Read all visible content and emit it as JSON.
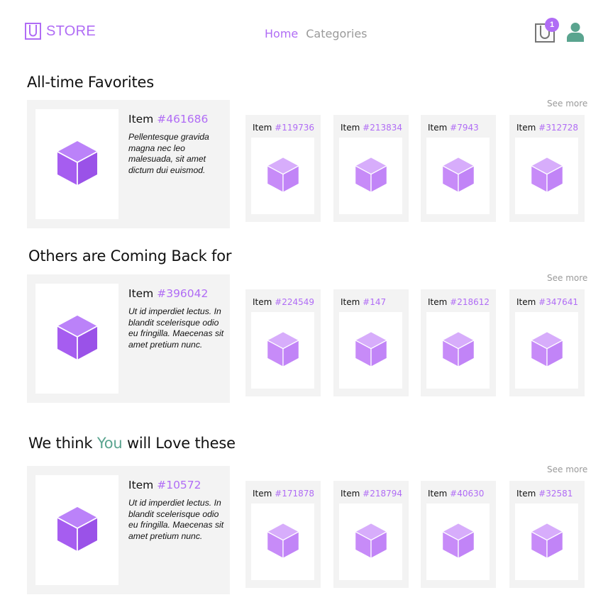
{
  "header": {
    "brand": "STORE",
    "nav": [
      {
        "label": "Home",
        "active": true
      },
      {
        "label": "Categories",
        "active": false
      }
    ],
    "cart_count": "1"
  },
  "colors": {
    "accent": "#b06cf5",
    "secondary": "#5aa48f",
    "muted": "#9a9a9a",
    "card_bg": "#f3f3f3"
  },
  "sections": [
    {
      "title_pre": "All-time Favorites",
      "title_hl": "",
      "title_post": "",
      "see_more": "See more",
      "featured": {
        "prefix": "Item ",
        "number": "#461686",
        "desc": "Pellentesque gravida magna nec leo malesuada, sit amet dictum dui euismod."
      },
      "items": [
        {
          "prefix": "Item ",
          "number": "#119736"
        },
        {
          "prefix": "Item ",
          "number": "#213834"
        },
        {
          "prefix": "Item ",
          "number": "#7943"
        },
        {
          "prefix": "Item ",
          "number": "#312728"
        }
      ]
    },
    {
      "title_pre": "Others are Coming Back for",
      "title_hl": "",
      "title_post": "",
      "see_more": "See more",
      "featured": {
        "prefix": "Item ",
        "number": "#396042",
        "desc": "Ut id imperdiet lectus. In blandit scelerisque odio eu fringilla. Maecenas sit amet pretium nunc."
      },
      "items": [
        {
          "prefix": "Item ",
          "number": "#224549"
        },
        {
          "prefix": "Item ",
          "number": "#147"
        },
        {
          "prefix": "Item ",
          "number": "#218612"
        },
        {
          "prefix": "Item ",
          "number": "#347641"
        }
      ]
    },
    {
      "title_pre": "We think ",
      "title_hl": "You",
      "title_post": " will Love these",
      "see_more": "See more",
      "featured": {
        "prefix": "Item ",
        "number": "#10572",
        "desc": "Ut id imperdiet lectus. In blandit scelerisque odio eu fringilla. Maecenas sit amet pretium nunc."
      },
      "items": [
        {
          "prefix": "Item ",
          "number": "#171878"
        },
        {
          "prefix": "Item ",
          "number": "#218794"
        },
        {
          "prefix": "Item ",
          "number": "#40630"
        },
        {
          "prefix": "Item ",
          "number": "#32581"
        }
      ]
    }
  ]
}
